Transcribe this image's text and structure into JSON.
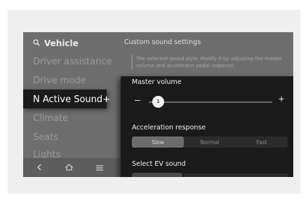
{
  "sidebar": {
    "search_label": "Vehicle",
    "search_icon": "search-icon",
    "items": [
      {
        "label": "Driver assistance"
      },
      {
        "label": "Drive mode"
      },
      {
        "label": "N Active Sound+"
      },
      {
        "label": "Climate"
      },
      {
        "label": "Seats"
      },
      {
        "label": "Lights"
      }
    ],
    "active_index": 2
  },
  "bottom_nav": {
    "back_icon": "back-chevron-icon",
    "home_icon": "home-icon",
    "menu_icon": "menu-icon"
  },
  "panel": {
    "title": "Custom sound settings",
    "info_text": "The selected sound style. Modify it by adjusting the master volume and accelerator pedal response."
  },
  "popup": {
    "master_volume": {
      "label": "Master volume",
      "minus_label": "–",
      "plus_label": "+",
      "value": "1"
    },
    "acceleration_response": {
      "label": "Acceleration response",
      "options": [
        "Slow",
        "Normal",
        "Fast"
      ],
      "selected": "Slow"
    },
    "ev_sound": {
      "label": "Select EV sound"
    }
  },
  "colors": {
    "screen_bg": "#6e6e6e",
    "popup_bg": "#1a1a1a",
    "active_item_bg": "#1b1b1b"
  }
}
